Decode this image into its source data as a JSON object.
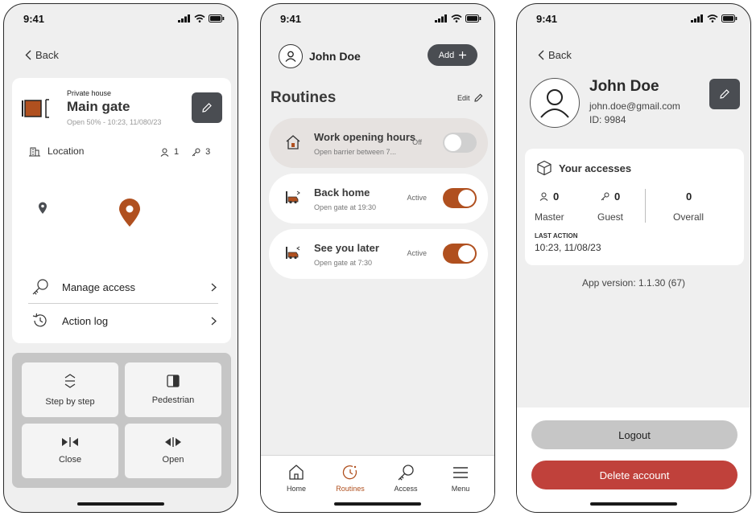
{
  "status_time": "9:41",
  "screen1": {
    "back": "Back",
    "subtitle": "Private house",
    "title": "Main gate",
    "status": "Open 50% - 10:23, 11/080/23",
    "location": "Location",
    "masters": "1",
    "guests": "3",
    "manage_access": "Manage access",
    "action_log": "Action log",
    "controls": {
      "step": "Step by step",
      "pedestrian": "Pedestrian",
      "close": "Close",
      "open": "Open"
    }
  },
  "screen2": {
    "user": "John Doe",
    "add": "Add",
    "section": "Routines",
    "edit": "Edit",
    "routines": [
      {
        "title": "Work opening hours",
        "subtitle": "Open barrier between 7...",
        "state": "Off"
      },
      {
        "title": "Back home",
        "subtitle": "Open gate at 19:30",
        "state": "Active"
      },
      {
        "title": "See you later",
        "subtitle": "Open gate at 7:30",
        "state": "Active"
      }
    ],
    "tabs": [
      "Home",
      "Routines",
      "Access",
      "Menu"
    ]
  },
  "screen3": {
    "back": "Back",
    "name": "John Doe",
    "email": "john.doe@gmail.com",
    "id": "ID: 9984",
    "accesses_title": "Your accesses",
    "master_count": "0",
    "master_label": "Master",
    "guest_count": "0",
    "guest_label": "Guest",
    "overall_count": "0",
    "overall_label": "Overall",
    "last_action_label": "LAST ACTION",
    "last_action": "10:23, 11/08/23",
    "version": "App version: 1.1.30 (67)",
    "logout": "Logout",
    "delete": "Delete account"
  },
  "colors": {
    "accent": "#b0501f",
    "dark_button": "#4a4d52",
    "danger": "#c0413b"
  }
}
